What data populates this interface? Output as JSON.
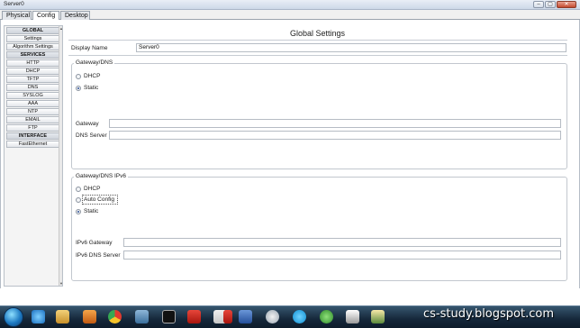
{
  "window": {
    "title": "Server0",
    "controls": {
      "minimize": "–",
      "maximize": "▢",
      "close": "✕"
    }
  },
  "tabs": [
    {
      "label": "Physical"
    },
    {
      "label": "Config"
    },
    {
      "label": "Desktop"
    }
  ],
  "sidebar": {
    "items": [
      {
        "label": "GLOBAL",
        "kind": "header"
      },
      {
        "label": "Settings",
        "kind": "item"
      },
      {
        "label": "Algorithm Settings",
        "kind": "item"
      },
      {
        "label": "SERVICES",
        "kind": "header"
      },
      {
        "label": "HTTP",
        "kind": "item"
      },
      {
        "label": "DHCP",
        "kind": "item"
      },
      {
        "label": "TFTP",
        "kind": "item"
      },
      {
        "label": "DNS",
        "kind": "item"
      },
      {
        "label": "SYSLOG",
        "kind": "item"
      },
      {
        "label": "AAA",
        "kind": "item"
      },
      {
        "label": "NTP",
        "kind": "item"
      },
      {
        "label": "EMAIL",
        "kind": "item"
      },
      {
        "label": "FTP",
        "kind": "item"
      },
      {
        "label": "INTERFACE",
        "kind": "header"
      },
      {
        "label": "FastEthernet",
        "kind": "item"
      }
    ]
  },
  "main": {
    "title": "Global Settings",
    "display_name": {
      "label": "Display Name",
      "value": "Server0"
    },
    "ipv4": {
      "group_title": "Gateway/DNS",
      "options": [
        {
          "label": "DHCP",
          "checked": false
        },
        {
          "label": "Static",
          "checked": true
        }
      ],
      "gateway": {
        "label": "Gateway",
        "value": ""
      },
      "dns": {
        "label": "DNS Server",
        "value": ""
      }
    },
    "ipv6": {
      "group_title": "Gateway/DNS IPv6",
      "options": [
        {
          "label": "DHCP",
          "checked": false
        },
        {
          "label": "Auto Config",
          "checked": false
        },
        {
          "label": "Static",
          "checked": true
        }
      ],
      "gateway": {
        "label": "IPv6 Gateway",
        "value": ""
      },
      "dns": {
        "label": "IPv6 DNS Server",
        "value": ""
      }
    }
  },
  "taskbar": {
    "watermark": "cs-study.blogspot.com",
    "icons": [
      "ie-icon",
      "explorer-icon",
      "media-player-icon",
      "chrome-icon",
      "network-icon",
      "terminal-icon",
      "pdf-icon",
      "java-icon",
      "pdf-reader-icon",
      "word-icon",
      "paint-icon",
      "skype-icon",
      "utorrent-icon",
      "clapper-icon",
      "packet-tracer-icon"
    ]
  }
}
